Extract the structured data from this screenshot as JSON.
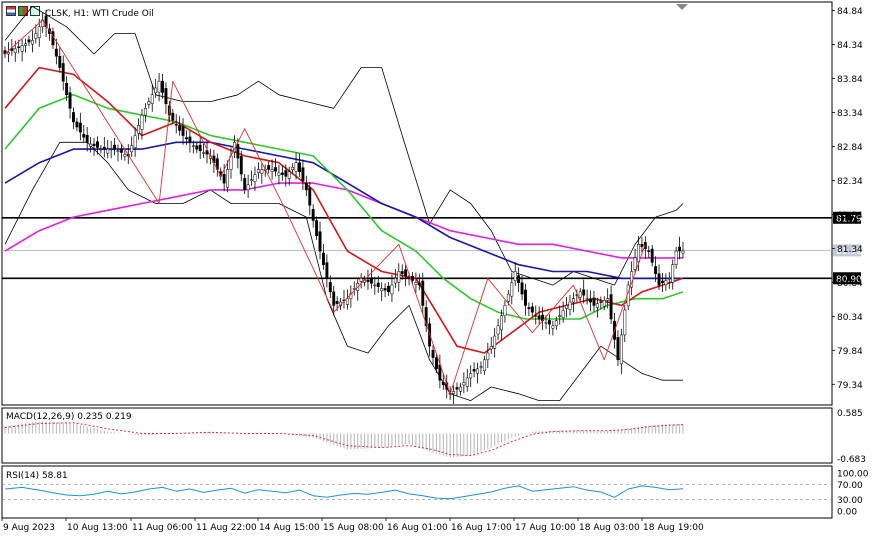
{
  "header": {
    "title": "CLSK, H1:  WTI Crude Oil"
  },
  "icons": [
    "bar-chart-icon",
    "candle-chart-icon",
    "line-chart-icon"
  ],
  "colors": {
    "candle": "#000000",
    "zigzag": "#e03030",
    "ma_fast": "#d01818",
    "ma_mid": "#2cc82c",
    "ma_slow": "#1818a8",
    "ma_long": "#e020e0",
    "bollinger": "#000000",
    "macd_hist": "#b4b4b4",
    "macd_signal": "#e02020",
    "rsi": "#2090e0",
    "current_line": "#a0b0c8"
  },
  "chart_data": [
    {
      "type": "candlestick",
      "title": "CLSK, H1:  WTI Crude Oil",
      "ylim": [
        79.05,
        84.95
      ],
      "y_ticks": [
        "84.84",
        "84.34",
        "83.84",
        "83.34",
        "82.84",
        "82.34",
        "81.84",
        "81.34",
        "80.84",
        "80.34",
        "79.84",
        "79.34"
      ],
      "x_ticks": [
        "9 Aug 2023",
        "10 Aug 13:00",
        "11 Aug 06:00",
        "11 Aug 22:00",
        "14 Aug 15:00",
        "15 Aug 08:00",
        "16 Aug 01:00",
        "16 Aug 17:00",
        "17 Aug 10:00",
        "18 Aug 03:00",
        "18 Aug 19:00"
      ],
      "horizontal_levels": [
        {
          "value": 81.79,
          "label": "81.79"
        },
        {
          "value": 80.9,
          "label": "80.90"
        }
      ],
      "current_price": {
        "value": 81.31,
        "label": "81.31"
      },
      "close_anchors": [
        [
          0,
          84.2
        ],
        [
          4,
          84.3
        ],
        [
          8,
          84.4
        ],
        [
          11,
          84.7
        ],
        [
          13,
          84.5
        ],
        [
          16,
          84.0
        ],
        [
          20,
          83.2
        ],
        [
          24,
          82.9
        ],
        [
          28,
          82.8
        ],
        [
          32,
          82.8
        ],
        [
          36,
          82.7
        ],
        [
          40,
          83.3
        ],
        [
          45,
          83.8
        ],
        [
          48,
          83.3
        ],
        [
          52,
          83.0
        ],
        [
          56,
          82.8
        ],
        [
          60,
          82.7
        ],
        [
          64,
          82.3
        ],
        [
          67,
          82.9
        ],
        [
          70,
          82.2
        ],
        [
          74,
          82.5
        ],
        [
          78,
          82.5
        ],
        [
          82,
          82.4
        ],
        [
          85,
          82.6
        ],
        [
          88,
          82.2
        ],
        [
          92,
          81.3
        ],
        [
          96,
          80.5
        ],
        [
          100,
          80.6
        ],
        [
          104,
          80.9
        ],
        [
          108,
          80.8
        ],
        [
          112,
          80.7
        ],
        [
          115,
          81.0
        ],
        [
          118,
          80.9
        ],
        [
          121,
          80.8
        ],
        [
          124,
          79.9
        ],
        [
          127,
          79.4
        ],
        [
          130,
          79.2
        ],
        [
          133,
          79.3
        ],
        [
          136,
          79.5
        ],
        [
          139,
          79.6
        ],
        [
          142,
          79.9
        ],
        [
          146,
          80.5
        ],
        [
          149,
          81.0
        ],
        [
          152,
          80.5
        ],
        [
          156,
          80.3
        ],
        [
          160,
          80.2
        ],
        [
          164,
          80.5
        ],
        [
          168,
          80.7
        ],
        [
          172,
          80.5
        ],
        [
          176,
          80.6
        ],
        [
          179,
          79.7
        ],
        [
          182,
          80.8
        ],
        [
          185,
          81.4
        ],
        [
          188,
          81.3
        ],
        [
          191,
          80.8
        ],
        [
          194,
          80.9
        ],
        [
          196,
          81.3
        ],
        [
          198,
          81.3
        ]
      ],
      "zigzag": [
        [
          0,
          84.2
        ],
        [
          11,
          84.7
        ],
        [
          45,
          82.0
        ],
        [
          49,
          83.8
        ],
        [
          63,
          82.4
        ],
        [
          70,
          83.1
        ],
        [
          82,
          81.9
        ],
        [
          96,
          80.4
        ],
        [
          115,
          81.4
        ],
        [
          130,
          79.2
        ],
        [
          141,
          80.9
        ],
        [
          154,
          80.1
        ],
        [
          166,
          80.8
        ],
        [
          175,
          79.7
        ],
        [
          187,
          81.4
        ]
      ],
      "ma_fast": [
        [
          0,
          83.4
        ],
        [
          10,
          84.0
        ],
        [
          20,
          83.9
        ],
        [
          30,
          83.5
        ],
        [
          40,
          83.0
        ],
        [
          50,
          83.2
        ],
        [
          60,
          82.9
        ],
        [
          70,
          82.7
        ],
        [
          80,
          82.6
        ],
        [
          90,
          82.2
        ],
        [
          100,
          81.3
        ],
        [
          110,
          81.0
        ],
        [
          120,
          80.9
        ],
        [
          126,
          80.4
        ],
        [
          132,
          79.9
        ],
        [
          140,
          79.8
        ],
        [
          148,
          80.1
        ],
        [
          156,
          80.4
        ],
        [
          164,
          80.5
        ],
        [
          172,
          80.6
        ],
        [
          180,
          80.5
        ],
        [
          186,
          80.7
        ],
        [
          192,
          80.8
        ],
        [
          198,
          80.9
        ]
      ],
      "ma_mid": [
        [
          0,
          82.8
        ],
        [
          10,
          83.4
        ],
        [
          20,
          83.6
        ],
        [
          30,
          83.4
        ],
        [
          40,
          83.3
        ],
        [
          50,
          83.2
        ],
        [
          60,
          83.0
        ],
        [
          70,
          82.9
        ],
        [
          80,
          82.8
        ],
        [
          90,
          82.7
        ],
        [
          100,
          82.2
        ],
        [
          110,
          81.6
        ],
        [
          120,
          81.3
        ],
        [
          128,
          80.9
        ],
        [
          136,
          80.6
        ],
        [
          144,
          80.4
        ],
        [
          152,
          80.3
        ],
        [
          160,
          80.3
        ],
        [
          168,
          80.3
        ],
        [
          176,
          80.5
        ],
        [
          184,
          80.6
        ],
        [
          192,
          80.6
        ],
        [
          198,
          80.7
        ]
      ],
      "ma_slow": [
        [
          0,
          82.3
        ],
        [
          10,
          82.6
        ],
        [
          20,
          82.8
        ],
        [
          30,
          82.8
        ],
        [
          40,
          82.8
        ],
        [
          50,
          82.9
        ],
        [
          60,
          82.9
        ],
        [
          70,
          82.8
        ],
        [
          80,
          82.7
        ],
        [
          90,
          82.6
        ],
        [
          100,
          82.3
        ],
        [
          110,
          82.0
        ],
        [
          120,
          81.8
        ],
        [
          130,
          81.5
        ],
        [
          140,
          81.3
        ],
        [
          150,
          81.1
        ],
        [
          160,
          81.0
        ],
        [
          170,
          81.0
        ],
        [
          180,
          80.9
        ],
        [
          190,
          80.9
        ],
        [
          198,
          80.9
        ]
      ],
      "ma_long": [
        [
          0,
          81.3
        ],
        [
          10,
          81.6
        ],
        [
          20,
          81.8
        ],
        [
          30,
          81.9
        ],
        [
          40,
          82.0
        ],
        [
          50,
          82.1
        ],
        [
          60,
          82.2
        ],
        [
          70,
          82.2
        ],
        [
          80,
          82.3
        ],
        [
          90,
          82.3
        ],
        [
          100,
          82.2
        ],
        [
          110,
          82.0
        ],
        [
          120,
          81.8
        ],
        [
          130,
          81.6
        ],
        [
          140,
          81.5
        ],
        [
          150,
          81.4
        ],
        [
          160,
          81.4
        ],
        [
          170,
          81.3
        ],
        [
          180,
          81.2
        ],
        [
          190,
          81.2
        ],
        [
          198,
          81.2
        ]
      ],
      "bollinger_upper": [
        [
          0,
          84.4
        ],
        [
          8,
          84.9
        ],
        [
          18,
          84.6
        ],
        [
          26,
          84.2
        ],
        [
          32,
          84.5
        ],
        [
          38,
          84.5
        ],
        [
          44,
          83.6
        ],
        [
          52,
          83.5
        ],
        [
          60,
          83.5
        ],
        [
          68,
          83.6
        ],
        [
          74,
          83.8
        ],
        [
          80,
          83.6
        ],
        [
          88,
          83.5
        ],
        [
          96,
          83.4
        ],
        [
          104,
          84.0
        ],
        [
          110,
          84.0
        ],
        [
          116,
          83.0
        ],
        [
          124,
          81.7
        ],
        [
          130,
          82.2
        ],
        [
          136,
          82.0
        ],
        [
          142,
          81.6
        ],
        [
          148,
          81.0
        ],
        [
          154,
          80.9
        ],
        [
          160,
          80.8
        ],
        [
          166,
          81.0
        ],
        [
          172,
          80.9
        ],
        [
          178,
          80.8
        ],
        [
          184,
          81.4
        ],
        [
          190,
          81.8
        ],
        [
          196,
          81.9
        ],
        [
          198,
          82.0
        ]
      ],
      "bollinger_lower": [
        [
          0,
          81.4
        ],
        [
          8,
          82.2
        ],
        [
          16,
          82.9
        ],
        [
          24,
          82.9
        ],
        [
          30,
          82.6
        ],
        [
          36,
          82.2
        ],
        [
          44,
          82.0
        ],
        [
          52,
          82.0
        ],
        [
          60,
          82.2
        ],
        [
          66,
          82.0
        ],
        [
          72,
          82.0
        ],
        [
          80,
          82.0
        ],
        [
          88,
          81.8
        ],
        [
          94,
          80.6
        ],
        [
          100,
          79.9
        ],
        [
          106,
          79.8
        ],
        [
          112,
          80.2
        ],
        [
          118,
          80.5
        ],
        [
          124,
          79.7
        ],
        [
          130,
          79.2
        ],
        [
          136,
          79.1
        ],
        [
          142,
          79.3
        ],
        [
          150,
          79.2
        ],
        [
          156,
          79.1
        ],
        [
          162,
          79.1
        ],
        [
          168,
          79.5
        ],
        [
          174,
          79.9
        ],
        [
          180,
          79.7
        ],
        [
          186,
          79.5
        ],
        [
          192,
          79.4
        ],
        [
          198,
          79.4
        ]
      ]
    },
    {
      "type": "bar",
      "name": "MACD",
      "label": "MACD(12,26,9) 0.235 0.219",
      "ylim": [
        -0.683,
        0.585
      ],
      "y_ticks": [
        "0.585",
        "-0.683"
      ],
      "histogram_anchors": [
        [
          0,
          0.18
        ],
        [
          10,
          0.3
        ],
        [
          20,
          0.25
        ],
        [
          30,
          0.05
        ],
        [
          40,
          -0.05
        ],
        [
          50,
          0.02
        ],
        [
          60,
          0.05
        ],
        [
          70,
          -0.02
        ],
        [
          80,
          0.0
        ],
        [
          90,
          -0.1
        ],
        [
          100,
          -0.4
        ],
        [
          110,
          -0.35
        ],
        [
          118,
          -0.25
        ],
        [
          124,
          -0.45
        ],
        [
          130,
          -0.6
        ],
        [
          136,
          -0.55
        ],
        [
          142,
          -0.35
        ],
        [
          148,
          -0.1
        ],
        [
          154,
          0.05
        ],
        [
          160,
          0.07
        ],
        [
          168,
          0.08
        ],
        [
          176,
          0.06
        ],
        [
          182,
          0.12
        ],
        [
          188,
          0.2
        ],
        [
          194,
          0.23
        ],
        [
          198,
          0.235
        ]
      ],
      "signal_anchors": [
        [
          0,
          0.15
        ],
        [
          10,
          0.25
        ],
        [
          20,
          0.27
        ],
        [
          30,
          0.12
        ],
        [
          40,
          0.0
        ],
        [
          50,
          0.0
        ],
        [
          60,
          0.03
        ],
        [
          70,
          0.0
        ],
        [
          80,
          0.0
        ],
        [
          90,
          -0.05
        ],
        [
          100,
          -0.3
        ],
        [
          110,
          -0.35
        ],
        [
          118,
          -0.3
        ],
        [
          124,
          -0.38
        ],
        [
          130,
          -0.52
        ],
        [
          136,
          -0.55
        ],
        [
          142,
          -0.42
        ],
        [
          148,
          -0.2
        ],
        [
          154,
          -0.02
        ],
        [
          160,
          0.05
        ],
        [
          168,
          0.07
        ],
        [
          176,
          0.07
        ],
        [
          182,
          0.1
        ],
        [
          188,
          0.17
        ],
        [
          194,
          0.21
        ],
        [
          198,
          0.219
        ]
      ]
    },
    {
      "type": "line",
      "name": "RSI",
      "label": "RSI(14) 58.81",
      "ylim": [
        0,
        100
      ],
      "y_ticks": [
        "100.00",
        "70.00",
        "30.00",
        "0.00"
      ],
      "levels": [
        70,
        30
      ],
      "rsi_anchors": [
        [
          0,
          58
        ],
        [
          5,
          62
        ],
        [
          10,
          55
        ],
        [
          14,
          48
        ],
        [
          18,
          42
        ],
        [
          22,
          40
        ],
        [
          26,
          44
        ],
        [
          30,
          52
        ],
        [
          34,
          45
        ],
        [
          38,
          50
        ],
        [
          42,
          58
        ],
        [
          46,
          62
        ],
        [
          50,
          52
        ],
        [
          54,
          58
        ],
        [
          58,
          49
        ],
        [
          62,
          55
        ],
        [
          66,
          60
        ],
        [
          70,
          47
        ],
        [
          74,
          56
        ],
        [
          78,
          52
        ],
        [
          82,
          48
        ],
        [
          86,
          55
        ],
        [
          90,
          40
        ],
        [
          94,
          36
        ],
        [
          98,
          42
        ],
        [
          102,
          46
        ],
        [
          106,
          44
        ],
        [
          110,
          49
        ],
        [
          114,
          55
        ],
        [
          118,
          45
        ],
        [
          122,
          40
        ],
        [
          126,
          34
        ],
        [
          130,
          32
        ],
        [
          134,
          38
        ],
        [
          138,
          44
        ],
        [
          142,
          50
        ],
        [
          146,
          60
        ],
        [
          150,
          66
        ],
        [
          154,
          52
        ],
        [
          158,
          56
        ],
        [
          162,
          60
        ],
        [
          166,
          64
        ],
        [
          170,
          55
        ],
        [
          174,
          50
        ],
        [
          178,
          36
        ],
        [
          182,
          58
        ],
        [
          186,
          66
        ],
        [
          190,
          62
        ],
        [
          194,
          56
        ],
        [
          198,
          58.81
        ]
      ]
    }
  ]
}
